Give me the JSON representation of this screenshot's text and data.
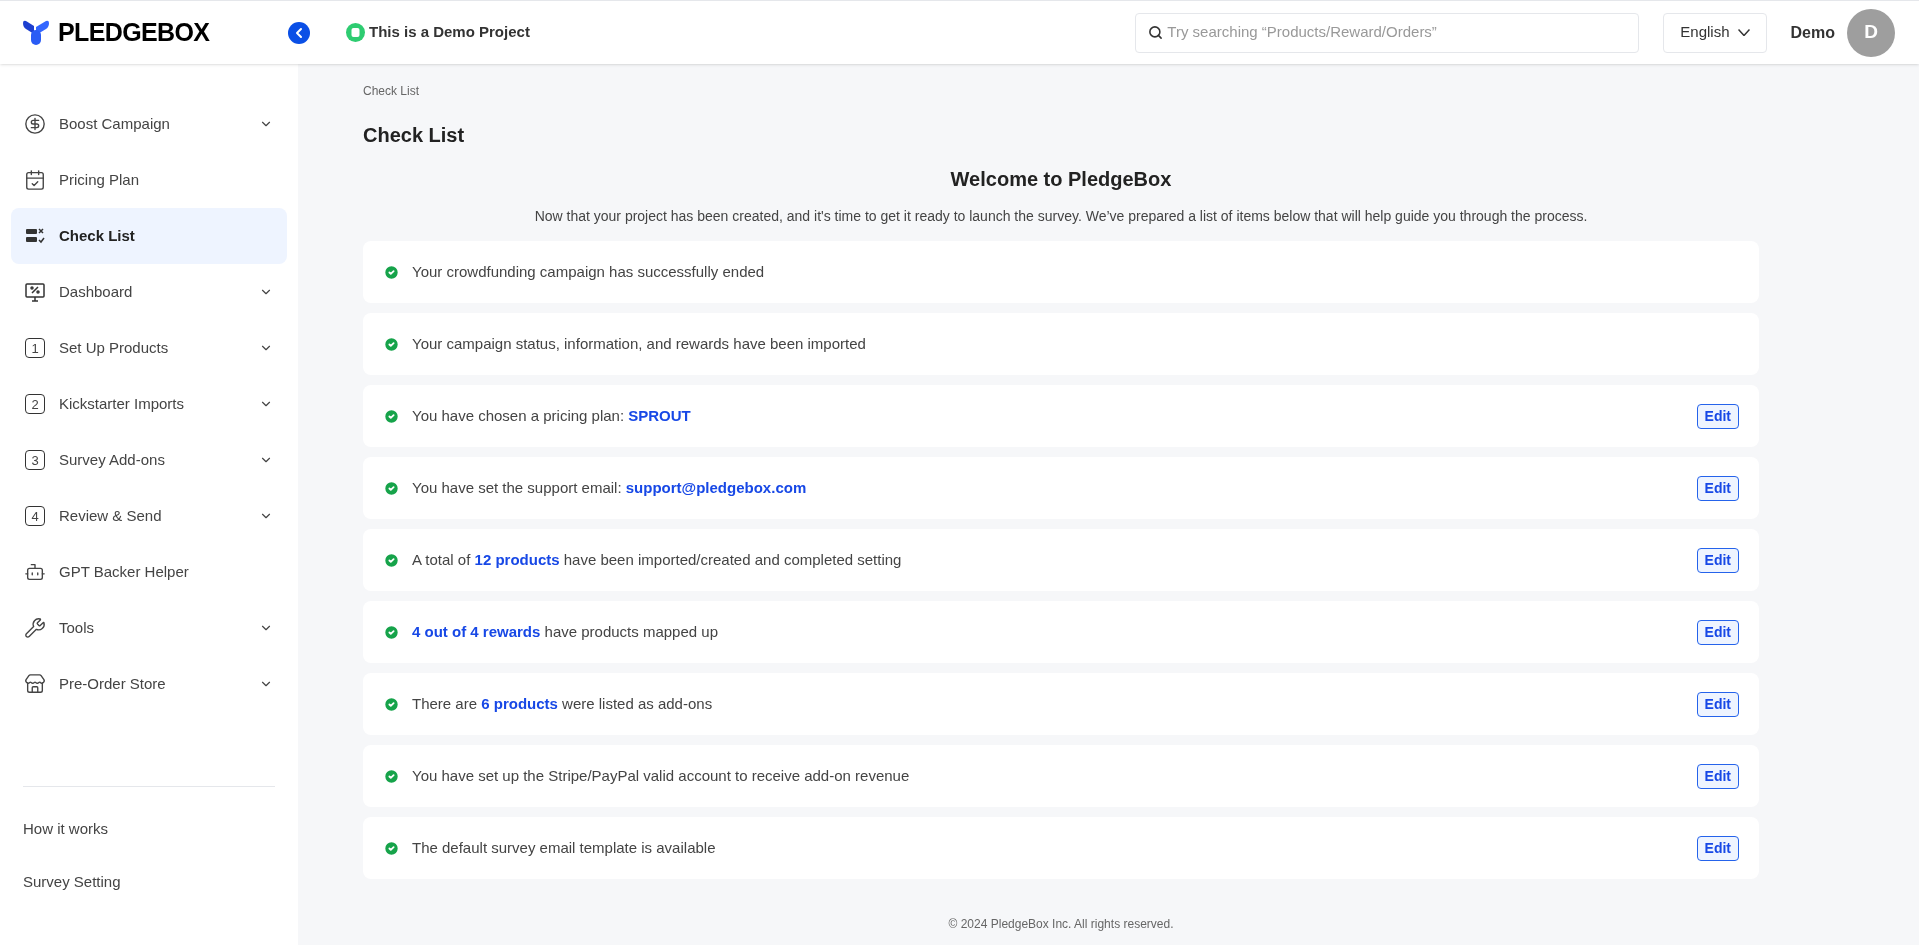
{
  "header": {
    "logo": "PLEDGEBOX",
    "project": "This is a Demo Project",
    "search": {
      "placeholder": "Try searching “Products/Reward/Orders”"
    },
    "language": "English",
    "user": "Demo",
    "avatar": "D"
  },
  "sidebar": {
    "items": [
      {
        "label": "Boost Campaign",
        "selected": false,
        "expandable": true
      },
      {
        "label": "Pricing Plan",
        "selected": false,
        "expandable": false
      },
      {
        "label": "Check List",
        "selected": true,
        "expandable": false
      },
      {
        "label": "Dashboard",
        "selected": false,
        "expandable": true
      },
      {
        "label": "Set Up Products",
        "number": "1",
        "selected": false,
        "expandable": true
      },
      {
        "label": "Kickstarter Imports",
        "number": "2",
        "selected": false,
        "expandable": true
      },
      {
        "label": "Survey Add-ons",
        "number": "3",
        "selected": false,
        "expandable": true
      },
      {
        "label": "Review & Send",
        "number": "4",
        "selected": false,
        "expandable": true
      },
      {
        "label": "GPT Backer Helper",
        "selected": false,
        "expandable": false
      },
      {
        "label": "Tools",
        "selected": false,
        "expandable": true
      },
      {
        "label": "Pre-Order Store",
        "selected": false,
        "expandable": true
      }
    ],
    "links": [
      "How it works",
      "Survey Setting"
    ]
  },
  "breadcrumb": "Check List",
  "title": "Check List",
  "welcome": "Welcome to PledgeBox",
  "intro": "Now that your project has been created, and it's time to get it ready to launch the survey. We’ve prepared a list of items below that will help guide you through the process.",
  "checklist": [
    {
      "text": "Your crowdfunding campaign has successfully ended",
      "done": true
    },
    {
      "text": "Your campaign status, information, and rewards have been imported",
      "done": true
    },
    {
      "text": "You have chosen a pricing plan: **SPROUT**",
      "done": true,
      "action": "Edit"
    },
    {
      "text": "You have set the support email: **support@pledgebox.com**",
      "done": true,
      "action": "Edit"
    },
    {
      "text": "A total of **12 products** have been imported/created and completed setting",
      "done": true,
      "action": "Edit"
    },
    {
      "text": "**4 out of 4 rewards** have products mapped up",
      "done": true,
      "action": "Edit"
    },
    {
      "text": "There are **6 products** were listed as add-ons",
      "done": true,
      "action": "Edit"
    },
    {
      "text": "You have set up the Stripe/PayPal valid account to receive add-on revenue",
      "done": true,
      "action": "Edit"
    },
    {
      "text": "The default survey email template is available",
      "done": true,
      "action": "Edit"
    }
  ],
  "footer": "© 2024 PledgeBox Inc. All rights reserved."
}
